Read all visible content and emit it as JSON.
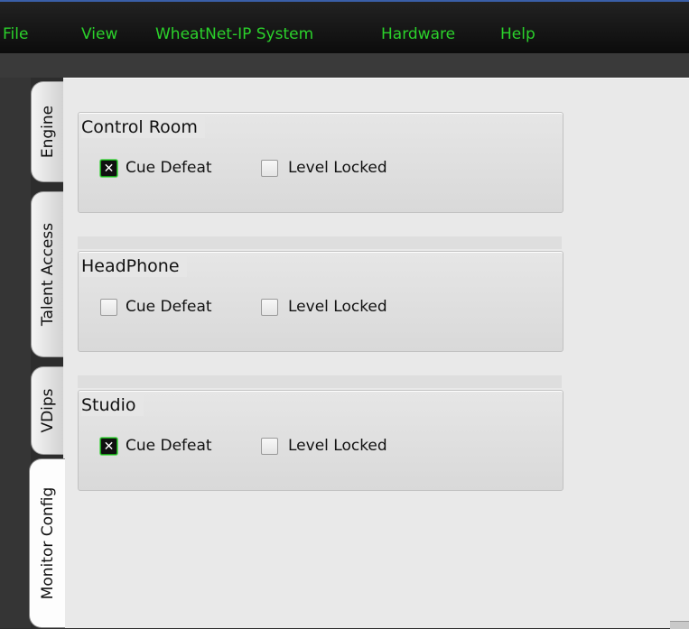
{
  "menu": [
    "File",
    "View",
    "WheatNet-IP System",
    "Hardware",
    "Help"
  ],
  "tabs": [
    {
      "label": "Engine",
      "active": false
    },
    {
      "label": "Talent Access",
      "active": false
    },
    {
      "label": "VDips",
      "active": false
    },
    {
      "label": "Monitor Config",
      "active": true
    }
  ],
  "groups": [
    {
      "title": "Control Room",
      "cue_defeat": {
        "label": "Cue Defeat",
        "checked": true
      },
      "level_locked": {
        "label": "Level Locked",
        "checked": false
      }
    },
    {
      "title": "HeadPhone",
      "cue_defeat": {
        "label": "Cue Defeat",
        "checked": false
      },
      "level_locked": {
        "label": "Level Locked",
        "checked": false
      }
    },
    {
      "title": "Studio",
      "cue_defeat": {
        "label": "Cue Defeat",
        "checked": true
      },
      "level_locked": {
        "label": "Level Locked",
        "checked": false
      }
    }
  ],
  "check_glyph": "✕",
  "colors": {
    "menu_text": "#2bd12b",
    "checked_border": "#18a018"
  }
}
